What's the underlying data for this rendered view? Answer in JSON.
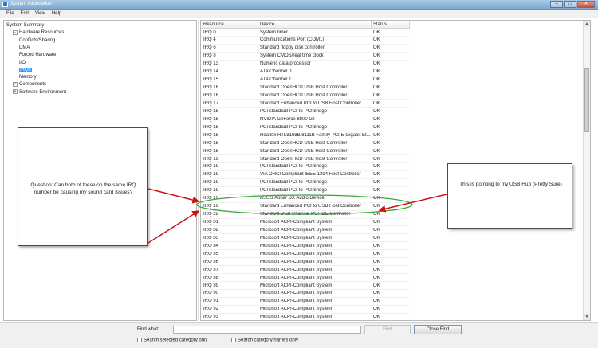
{
  "window": {
    "title": "System Information"
  },
  "menu": [
    "File",
    "Edit",
    "View",
    "Help"
  ],
  "tree": [
    {
      "label": "System Summary",
      "indent": 0,
      "expander": ""
    },
    {
      "label": "Hardware Resources",
      "indent": 1,
      "expander": "-"
    },
    {
      "label": "Conflicts/Sharing",
      "indent": 2,
      "expander": ""
    },
    {
      "label": "DMA",
      "indent": 2,
      "expander": ""
    },
    {
      "label": "Forced Hardware",
      "indent": 2,
      "expander": ""
    },
    {
      "label": "I/O",
      "indent": 2,
      "expander": ""
    },
    {
      "label": "IRQs",
      "indent": 2,
      "expander": "",
      "selected": true
    },
    {
      "label": "Memory",
      "indent": 2,
      "expander": ""
    },
    {
      "label": "Components",
      "indent": 1,
      "expander": "+"
    },
    {
      "label": "Software Environment",
      "indent": 1,
      "expander": "+"
    }
  ],
  "list": {
    "columns": [
      "Resource",
      "Device",
      "Status"
    ],
    "rows": [
      [
        "IRQ 0",
        "System timer",
        "OK"
      ],
      [
        "IRQ 4",
        "Communications Port (COM1)",
        "OK"
      ],
      [
        "IRQ 6",
        "Standard floppy disk controller",
        "OK"
      ],
      [
        "IRQ 8",
        "System CMOS/real time clock",
        "OK"
      ],
      [
        "IRQ 13",
        "Numeric data processor",
        "OK"
      ],
      [
        "IRQ 14",
        "ATA Channel 0",
        "OK"
      ],
      [
        "IRQ 15",
        "ATA Channel 1",
        "OK"
      ],
      [
        "IRQ 16",
        "Standard OpenHCD USB Host Controller",
        "OK"
      ],
      [
        "IRQ 16",
        "Standard OpenHCD USB Host Controller",
        "OK"
      ],
      [
        "IRQ 17",
        "Standard Enhanced PCI to USB Host Controller",
        "OK"
      ],
      [
        "IRQ 18",
        "PCI standard PCI-to-PCI bridge",
        "OK"
      ],
      [
        "IRQ 18",
        "NVIDIA GeForce 8800 GT",
        "OK"
      ],
      [
        "IRQ 18",
        "PCI standard PCI-to-PCI bridge",
        "OK"
      ],
      [
        "IRQ 18",
        "Realtek RTL8168B/8111B Family PCI-E Gigabit Et...",
        "OK"
      ],
      [
        "IRQ 18",
        "Standard OpenHCD USB Host Controller",
        "OK"
      ],
      [
        "IRQ 18",
        "Standard OpenHCD USB Host Controller",
        "OK"
      ],
      [
        "IRQ 19",
        "Standard OpenHCD USB Host Controller",
        "OK"
      ],
      [
        "IRQ 19",
        "PCI standard PCI-to-PCI bridge",
        "OK"
      ],
      [
        "IRQ 19",
        "VIA OHCI Compliant IEEE 1394 Host Controller",
        "OK"
      ],
      [
        "IRQ 19",
        "PCI standard PCI-to-PCI bridge",
        "OK"
      ],
      [
        "IRQ 19",
        "PCI standard PCI-to-PCI bridge",
        "OK"
      ],
      [
        "IRQ 19",
        "ASUS Xonar DX Audio Device",
        "OK"
      ],
      [
        "IRQ 19",
        "Standard Enhanced PCI to USB Host Controller",
        "OK"
      ],
      [
        "IRQ 22",
        "Standard Dual Channel PCI IDE Controller",
        "OK"
      ],
      [
        "IRQ 81",
        "Microsoft ACPI-Compliant System",
        "OK"
      ],
      [
        "IRQ 82",
        "Microsoft ACPI-Compliant System",
        "OK"
      ],
      [
        "IRQ 83",
        "Microsoft ACPI-Compliant System",
        "OK"
      ],
      [
        "IRQ 84",
        "Microsoft ACPI-Compliant System",
        "OK"
      ],
      [
        "IRQ 85",
        "Microsoft ACPI-Compliant System",
        "OK"
      ],
      [
        "IRQ 86",
        "Microsoft ACPI-Compliant System",
        "OK"
      ],
      [
        "IRQ 87",
        "Microsoft ACPI-Compliant System",
        "OK"
      ],
      [
        "IRQ 88",
        "Microsoft ACPI-Compliant System",
        "OK"
      ],
      [
        "IRQ 89",
        "Microsoft ACPI-Compliant System",
        "OK"
      ],
      [
        "IRQ 90",
        "Microsoft ACPI-Compliant System",
        "OK"
      ],
      [
        "IRQ 91",
        "Microsoft ACPI-Compliant System",
        "OK"
      ],
      [
        "IRQ 92",
        "Microsoft ACPI-Compliant System",
        "OK"
      ],
      [
        "IRQ 93",
        "Microsoft ACPI-Compliant System",
        "OK"
      ]
    ]
  },
  "find": {
    "label": "Find what:",
    "value": "",
    "find_button": "Find",
    "close_button": "Close Find",
    "check_selected": "Search selected category only",
    "check_names": "Search category names only"
  },
  "annotations": {
    "left_text": "Question:  Can both of these on the same IRQ number be causing my sound card issues?",
    "right_text": "This is pointing to my USB Hub (Pretty Sure)",
    "arrow_color": "#cc1111",
    "ellipse_color": "#3aa83a"
  }
}
